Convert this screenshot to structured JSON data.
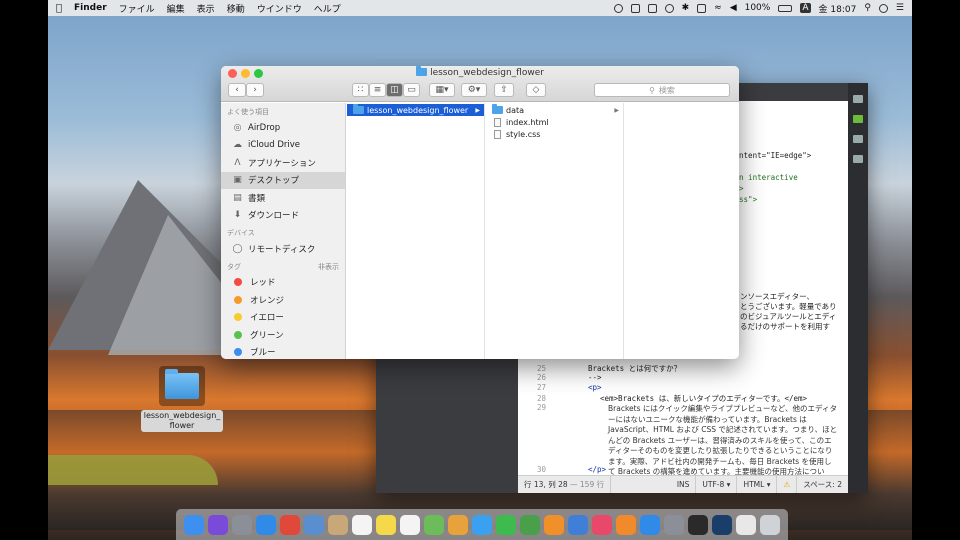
{
  "menubar": {
    "app_name": "Finder",
    "items": [
      "ファイル",
      "編集",
      "表示",
      "移動",
      "ウインドウ",
      "ヘルプ"
    ],
    "battery": "100%",
    "input_mode": "A",
    "clock": "金 18:07"
  },
  "finder": {
    "title": "lesson_webdesign_flower",
    "search_placeholder": "検索",
    "sidebar": {
      "favorites_header": "よく使う項目",
      "favorites": [
        {
          "label": "AirDrop",
          "icon": "airdrop-icon"
        },
        {
          "label": "iCloud Drive",
          "icon": "cloud-icon"
        },
        {
          "label": "アプリケーション",
          "icon": "applications-icon"
        },
        {
          "label": "デスクトップ",
          "icon": "desktop-icon"
        },
        {
          "label": "書類",
          "icon": "documents-icon"
        },
        {
          "label": "ダウンロード",
          "icon": "downloads-icon"
        }
      ],
      "devices_header": "デバイス",
      "devices": [
        {
          "label": "リモートディスク",
          "icon": "disc-icon"
        }
      ],
      "tags_header": "タグ",
      "tags_toggle": "非表示",
      "tags": [
        {
          "label": "レッド",
          "color": "#f24b3f"
        },
        {
          "label": "オレンジ",
          "color": "#f79a2a"
        },
        {
          "label": "イエロー",
          "color": "#f6cd2e"
        },
        {
          "label": "グリーン",
          "color": "#5ac14f"
        },
        {
          "label": "ブルー",
          "color": "#3a8ef0"
        }
      ]
    },
    "column1": [
      {
        "label": "lesson_webdesign_flower",
        "kind": "folder"
      }
    ],
    "column2": [
      {
        "label": "data",
        "kind": "folder"
      },
      {
        "label": "index.html",
        "kind": "file"
      },
      {
        "label": "style.css",
        "kind": "file"
      }
    ]
  },
  "editor": {
    "visible_fragments": [
      "content=\"IE=edge\">",
      "e",
      "\"An interactive",
      ".\">",
      ".css\">"
    ],
    "jp_fragment_lines": [
      "ンソースエディター、",
      "とうございます。軽量であり",
      "のビジュアルツールとエディ",
      "るだけのサポートを利用す"
    ],
    "lines": [
      {
        "num": "25",
        "text": "Brackets とは何ですか？"
      },
      {
        "num": "26",
        "text": "-->"
      },
      {
        "num": "27",
        "text": "<p>"
      },
      {
        "num": "28",
        "text": "<em>Brackets は、新しいタイプのエディターです。</em>"
      },
      {
        "num": "29",
        "text": ""
      },
      {
        "num": "30",
        "text": "</p>"
      }
    ],
    "paragraph": "Brackets にはクイック編集やライブプレビューなど、他のエディターにはないユニークな機能が備わっています。Brackets は JavaScript、HTML および CSS で記述されています。つまり、ほとんどの Brackets ユーザーは、習得済みのスキルを使って、このエディターそのものを変更したり拡張したりできるということになります。実際、アドビ社内の開発チームも、毎日 Brackets を使用して Brackets の構築を進めています。主要機能の使用方法について、下記で詳しくご説明します。",
    "status": {
      "position": "行 13, 列 28",
      "chars": "— 159 行",
      "mode": "INS",
      "encoding": "UTF-8 ▾",
      "language": "HTML ▾",
      "spaces": "スペース: 2"
    }
  },
  "desktop_folder": {
    "line1": "lesson_webdesign_",
    "line2": "flower"
  },
  "dock": {
    "apps": [
      {
        "icon": "finder-icon",
        "color": "#3d8ff0"
      },
      {
        "icon": "siri-icon",
        "color": "#7a4ad8"
      },
      {
        "icon": "launchpad-icon",
        "color": "#8a8f98"
      },
      {
        "icon": "safari-icon",
        "color": "#2f8ae8"
      },
      {
        "icon": "chrome-icon",
        "color": "#e0483a"
      },
      {
        "icon": "photos-viewer-icon",
        "color": "#5a8fcf"
      },
      {
        "icon": "contacts-icon",
        "color": "#c8a878"
      },
      {
        "icon": "calendar-icon",
        "color": "#f4f4f4"
      },
      {
        "icon": "notes-icon",
        "color": "#f5d94a"
      },
      {
        "icon": "reminders-icon",
        "color": "#f4f4f4"
      },
      {
        "icon": "maps-icon",
        "color": "#6cbc5a"
      },
      {
        "icon": "photos-icon",
        "color": "#e8a23c"
      },
      {
        "icon": "messages-icon",
        "color": "#3ca0f0"
      },
      {
        "icon": "facetime-icon",
        "color": "#3dbb4f"
      },
      {
        "icon": "numbers-icon",
        "color": "#4aa04a"
      },
      {
        "icon": "pages-icon",
        "color": "#f0902a"
      },
      {
        "icon": "keynote-icon",
        "color": "#3f7fd8"
      },
      {
        "icon": "itunes-icon",
        "color": "#e8486a"
      },
      {
        "icon": "ibooks-icon",
        "color": "#f08a2a"
      },
      {
        "icon": "appstore-icon",
        "color": "#2f8ae8"
      },
      {
        "icon": "system-preferences-icon",
        "color": "#8a8f98"
      },
      {
        "icon": "quicktime-icon",
        "color": "#2a2a2a"
      },
      {
        "icon": "brackets-icon",
        "color": "#1a3e6a"
      },
      {
        "icon": "downloads-stack-icon",
        "color": "#e8e8e8"
      },
      {
        "icon": "trash-icon",
        "color": "#cfd2d6"
      }
    ]
  }
}
